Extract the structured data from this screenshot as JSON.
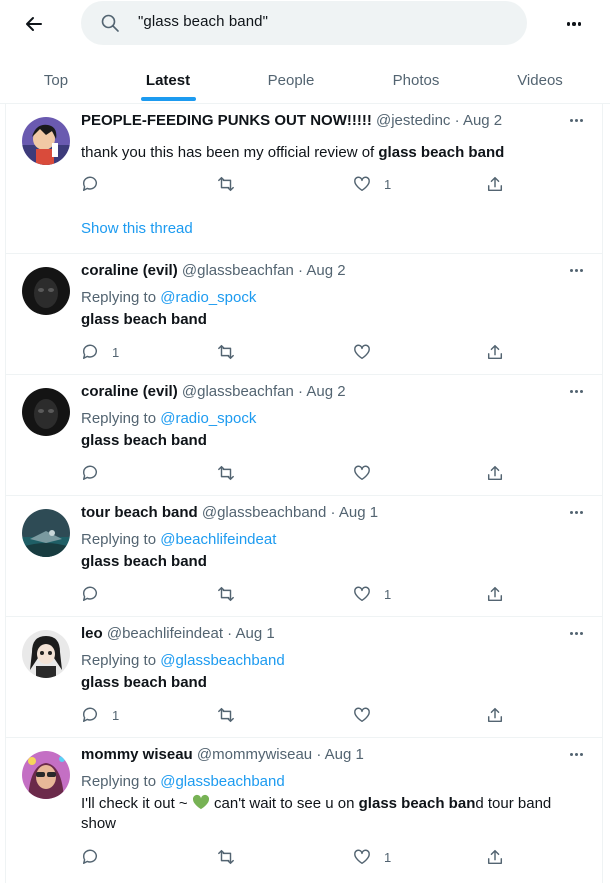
{
  "search": {
    "query": "\"glass beach band\""
  },
  "tabs": [
    {
      "label": "Top"
    },
    {
      "label": "Latest"
    },
    {
      "label": "People"
    },
    {
      "label": "Photos"
    },
    {
      "label": "Videos"
    }
  ],
  "colors": {
    "accent": "#1d9bf0",
    "text": "#0f1419",
    "muted": "#536471",
    "heart_emoji": "#77b255"
  },
  "tweets": [
    {
      "name": "PEOPLE-FEEDING PUNKS OUT NOW!!!!!",
      "handle": "@jestedinc",
      "date": "· Aug 2",
      "text_pre": "thank you this has been my official review of ",
      "text_bold": "glass beach band",
      "reply_count": "",
      "like_count": "1",
      "show_thread": "Show this thread"
    },
    {
      "name": "coraline (evil)",
      "handle": "@glassbeachfan",
      "date": "· Aug 2",
      "replying_prefix": "Replying to ",
      "replying_to": "@radio_spock",
      "text_bold": "glass beach band",
      "reply_count": "1",
      "like_count": ""
    },
    {
      "name": "coraline (evil)",
      "handle": "@glassbeachfan",
      "date": "· Aug 2",
      "replying_prefix": "Replying to ",
      "replying_to": "@radio_spock",
      "text_bold": "glass beach band",
      "reply_count": "",
      "like_count": ""
    },
    {
      "name": "tour beach band",
      "handle": "@glassbeachband",
      "date": "· Aug 1",
      "replying_prefix": "Replying to ",
      "replying_to": "@beachlifeindeat",
      "text_bold": "glass beach band",
      "reply_count": "",
      "like_count": "1"
    },
    {
      "name": "leo",
      "handle": "@beachlifeindeat",
      "date": "· Aug 1",
      "replying_prefix": "Replying to ",
      "replying_to": "@glassbeachband",
      "text_bold": "glass beach band",
      "reply_count": "1",
      "like_count": ""
    },
    {
      "name": "mommy wiseau",
      "handle": "@mommywiseau",
      "date": "· Aug 1",
      "replying_prefix": "Replying to ",
      "replying_to": "@glassbeachband",
      "text_pre": "I'll check it out ~ ",
      "text_mid": " can't wait to see u on ",
      "text_bold": "glass beach ban",
      "text_post": "d tour band show",
      "reply_count": "",
      "like_count": "1"
    }
  ]
}
